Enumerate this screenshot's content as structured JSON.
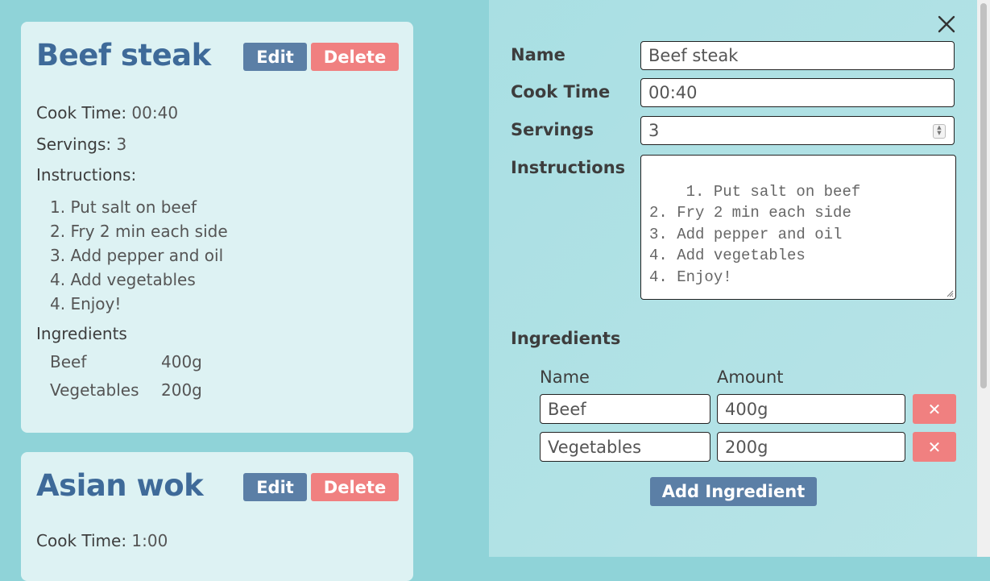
{
  "recipes": [
    {
      "title": "Beef steak",
      "edit_label": "Edit",
      "delete_label": "Delete",
      "cook_time_label": "Cook Time:",
      "cook_time": "00:40",
      "servings_label": "Servings:",
      "servings": "3",
      "instructions_label": "Instructions:",
      "instructions": [
        "1. Put salt on beef",
        "2. Fry 2 min each side",
        "3. Add pepper and oil",
        "4. Add vegetables",
        "4. Enjoy!"
      ],
      "ingredients_label": "Ingredients",
      "ingredients": [
        {
          "name": "Beef",
          "amount": "400g"
        },
        {
          "name": "Vegetables",
          "amount": "200g"
        }
      ]
    },
    {
      "title": "Asian wok",
      "edit_label": "Edit",
      "delete_label": "Delete",
      "cook_time_label": "Cook Time:",
      "cook_time": "1:00"
    }
  ],
  "editor": {
    "name_label": "Name",
    "name_value": "Beef steak",
    "cook_time_label": "Cook Time",
    "cook_time_value": "00:40",
    "servings_label": "Servings",
    "servings_value": "3",
    "instructions_label": "Instructions",
    "instructions_value": "1. Put salt on beef\n2. Fry 2 min each side\n3. Add pepper and oil\n4. Add vegetables\n4. Enjoy!",
    "ingredients_label": "Ingredients",
    "ingredient_name_header": "Name",
    "ingredient_amount_header": "Amount",
    "ingredients": [
      {
        "name": "Beef",
        "amount": "400g",
        "remove_label": "✕"
      },
      {
        "name": "Vegetables",
        "amount": "200g",
        "remove_label": "✕"
      }
    ],
    "add_ingredient_label": "Add Ingredient",
    "close_icon": "close-icon"
  },
  "colors": {
    "background": "#8fd3d8",
    "card": "#ddf2f3",
    "title": "#3e6a99",
    "primary_button": "#5b7fa6",
    "danger_button": "#f08080"
  }
}
